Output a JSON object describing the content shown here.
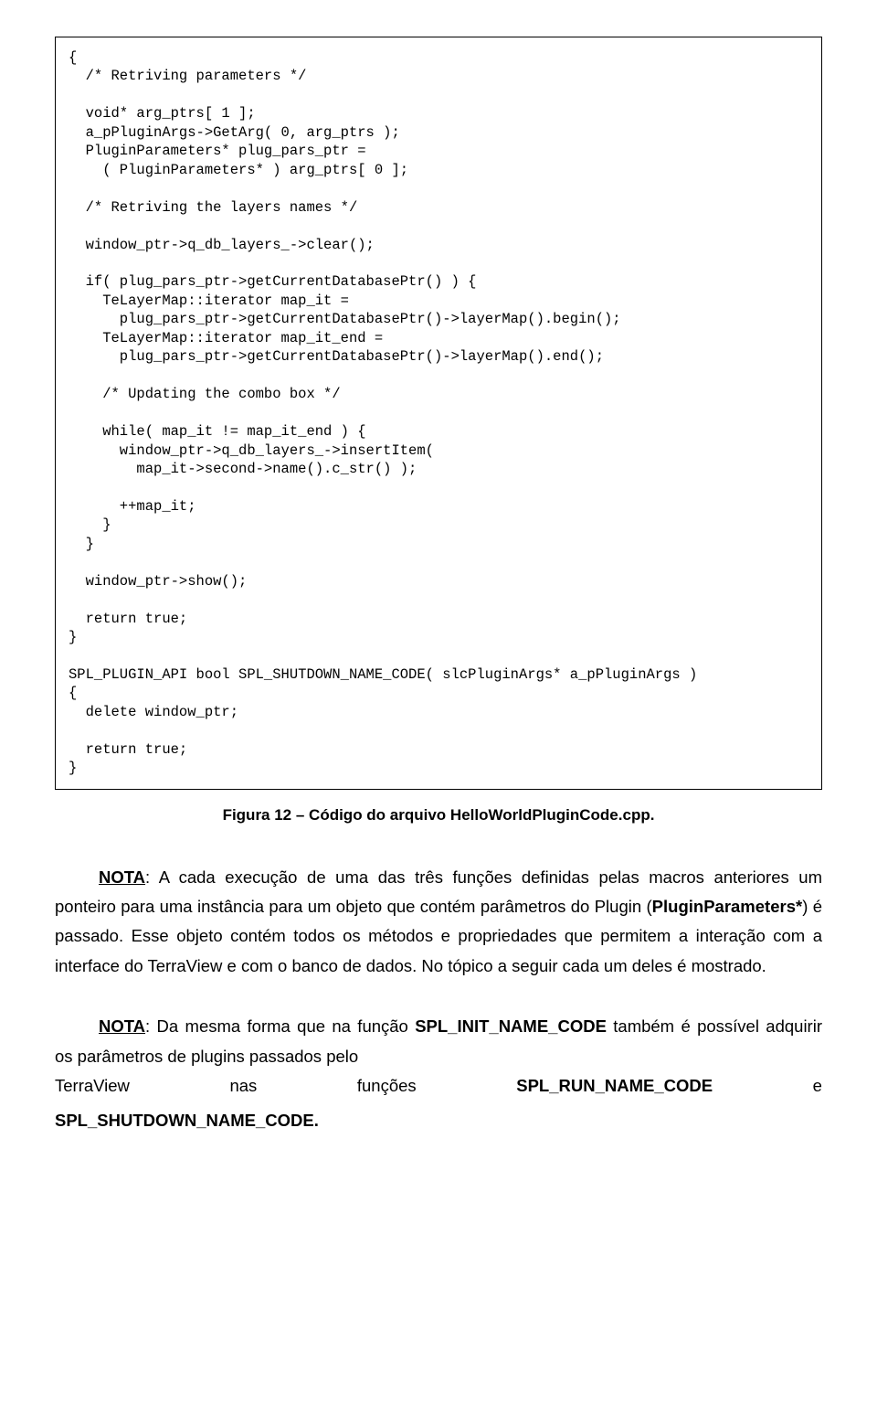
{
  "code": "{\n  /* Retriving parameters */\n\n  void* arg_ptrs[ 1 ];\n  a_pPluginArgs->GetArg( 0, arg_ptrs );\n  PluginParameters* plug_pars_ptr =\n    ( PluginParameters* ) arg_ptrs[ 0 ];\n\n  /* Retriving the layers names */\n\n  window_ptr->q_db_layers_->clear();\n\n  if( plug_pars_ptr->getCurrentDatabasePtr() ) {\n    TeLayerMap::iterator map_it =\n      plug_pars_ptr->getCurrentDatabasePtr()->layerMap().begin();\n    TeLayerMap::iterator map_it_end =\n      plug_pars_ptr->getCurrentDatabasePtr()->layerMap().end();\n\n    /* Updating the combo box */\n\n    while( map_it != map_it_end ) {\n      window_ptr->q_db_layers_->insertItem(\n        map_it->second->name().c_str() );\n\n      ++map_it;\n    }\n  }\n\n  window_ptr->show();\n\n  return true;\n}\n\nSPL_PLUGIN_API bool SPL_SHUTDOWN_NAME_CODE( slcPluginArgs* a_pPluginArgs )\n{\n  delete window_ptr;\n\n  return true;\n}",
  "caption": "Figura 12 – Código do arquivo HelloWorldPluginCode.cpp.",
  "para1": {
    "prefix": "NOTA",
    "rest1": ": A cada execução de uma das três funções definidas pelas macros anteriores um ponteiro para uma instância para um objeto que contém parâmetros do Plugin (",
    "bold1": "PluginParameters*",
    "rest2": ") é passado. Esse objeto contém todos os métodos e propriedades que permitem a interação com a interface do TerraView e com o banco de dados. No tópico a seguir cada um deles é mostrado."
  },
  "para2": {
    "prefix": "NOTA",
    "rest1": ": Da mesma forma que na função ",
    "bold1": "SPL_INIT_NAME_CODE",
    "rest2": " também é possível adquirir os parâmetros de plugins passados pelo"
  },
  "lastRow": {
    "c1": "TerraView",
    "c2": "nas",
    "c3": "funções",
    "c4": "SPL_RUN_NAME_CODE",
    "c5": "e"
  },
  "lastLine": "SPL_SHUTDOWN_NAME_CODE."
}
